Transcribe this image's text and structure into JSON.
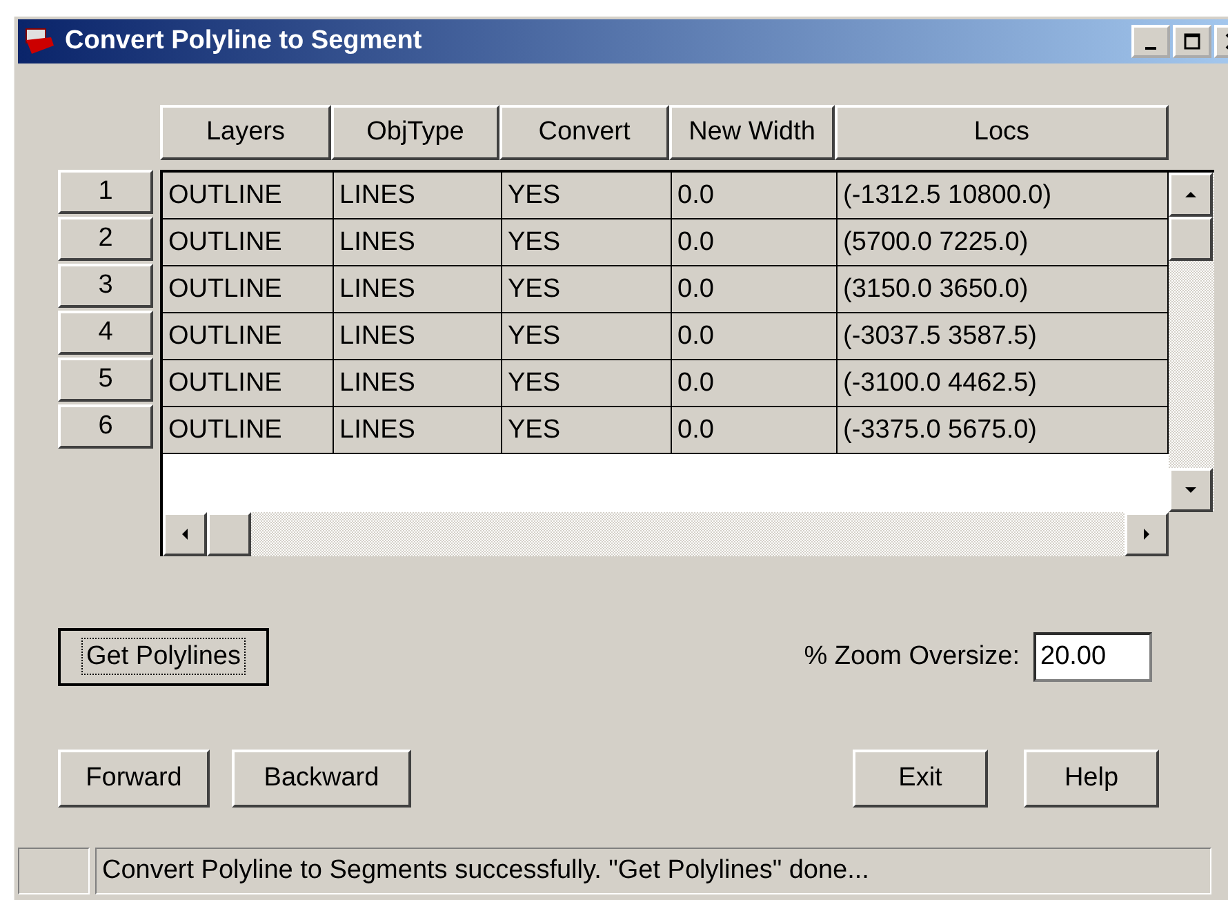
{
  "window": {
    "title": "Convert Polyline to Segment"
  },
  "table": {
    "columns": [
      "Layers",
      "ObjType",
      "Convert",
      "New Width",
      "Locs"
    ],
    "rows": [
      {
        "header": "1",
        "cells": [
          "OUTLINE",
          "LINES",
          "YES",
          "0.0",
          "(-1312.5 10800.0)"
        ]
      },
      {
        "header": "2",
        "cells": [
          "OUTLINE",
          "LINES",
          "YES",
          "0.0",
          "(5700.0 7225.0)"
        ]
      },
      {
        "header": "3",
        "cells": [
          "OUTLINE",
          "LINES",
          "YES",
          "0.0",
          "(3150.0 3650.0)"
        ]
      },
      {
        "header": "4",
        "cells": [
          "OUTLINE",
          "LINES",
          "YES",
          "0.0",
          "(-3037.5 3587.5)"
        ]
      },
      {
        "header": "5",
        "cells": [
          "OUTLINE",
          "LINES",
          "YES",
          "0.0",
          "(-3100.0 4462.5)"
        ]
      },
      {
        "header": "6",
        "cells": [
          "OUTLINE",
          "LINES",
          "YES",
          "0.0",
          "(-3375.0 5675.0)"
        ]
      }
    ]
  },
  "get_button": {
    "label": "Get Polylines",
    "focused": true
  },
  "zoom": {
    "label": "% Zoom Oversize:",
    "value": "20.00"
  },
  "nav_buttons": [
    "Forward",
    "Backward"
  ],
  "right_buttons": [
    "Exit",
    "Help"
  ],
  "status_bar": {
    "text": "Convert Polyline to Segments successfully. \"Get Polylines\" done..."
  }
}
